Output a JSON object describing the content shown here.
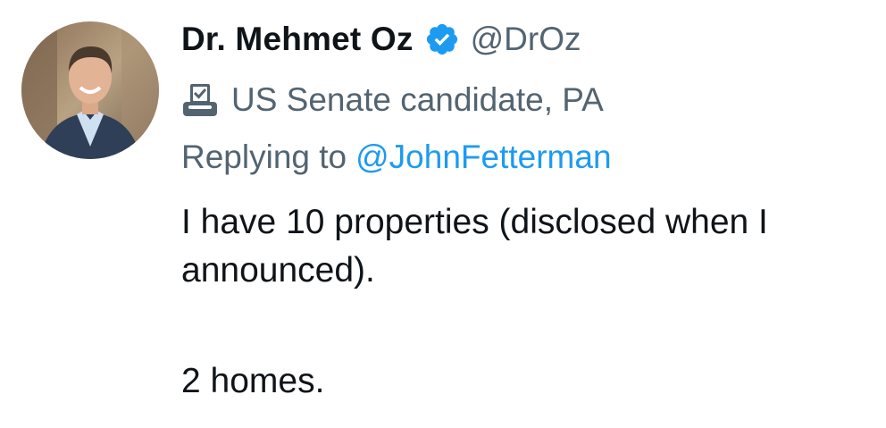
{
  "author": {
    "display_name": "Dr. Mehmet Oz",
    "handle": "@DrOz",
    "verified_icon": "verified-badge-icon",
    "label_icon": "ballot-box-icon",
    "label": "US Senate candidate, PA"
  },
  "reply": {
    "prefix": "Replying to",
    "to_handle": "@JohnFetterman"
  },
  "tweet": {
    "line1": "I have 10 properties (disclosed when I",
    "line2": "announced).",
    "line3": "2 homes."
  },
  "colors": {
    "verified": "#1d9bf0",
    "link": "#1d9bf0",
    "secondary": "#536471",
    "text": "#0f1419"
  }
}
